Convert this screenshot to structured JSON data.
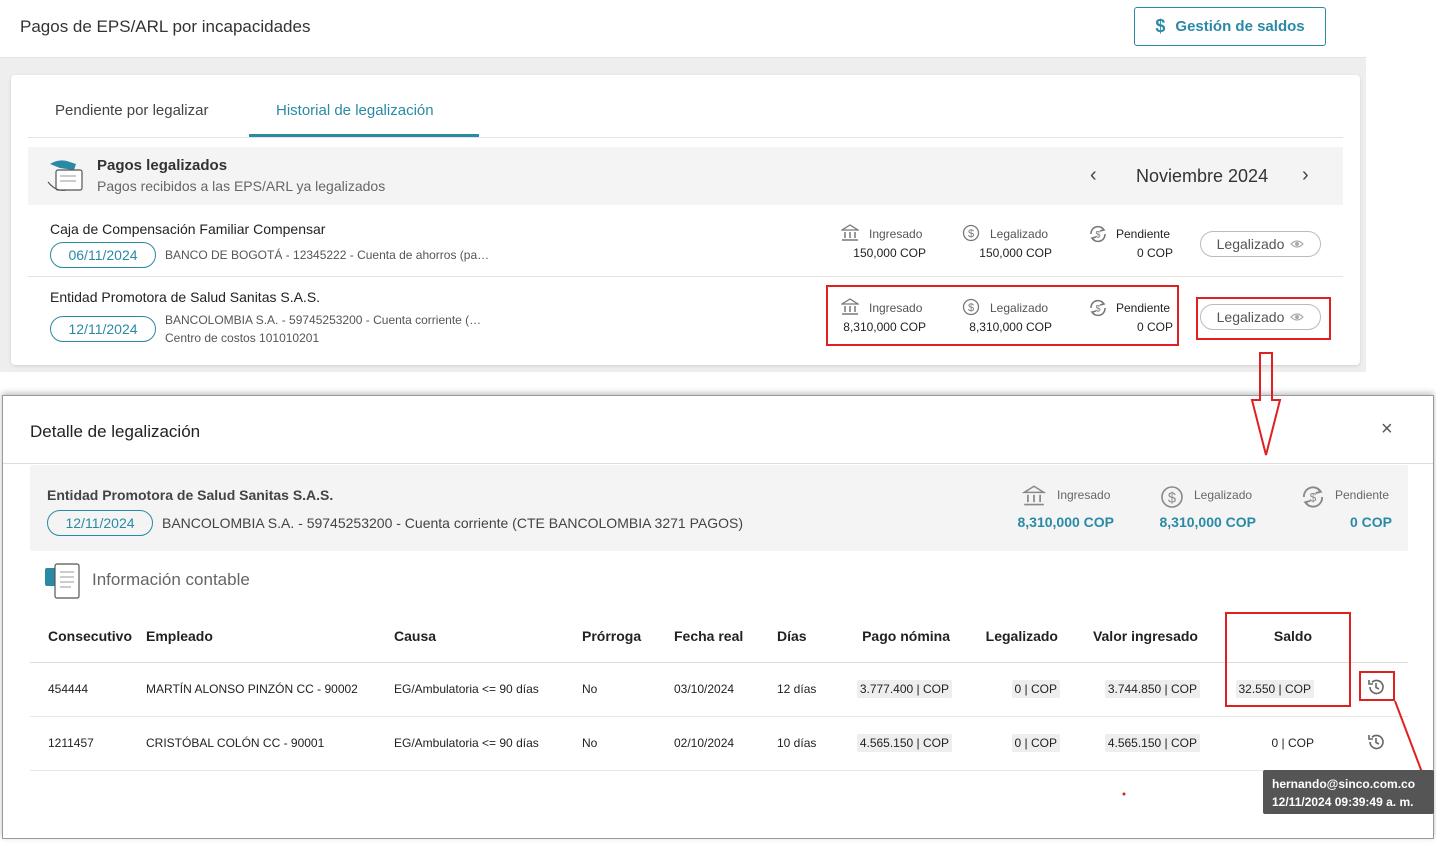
{
  "page": {
    "title": "Pagos de EPS/ARL por incapacidades",
    "saldos_button": "Gestión de saldos",
    "saldos_icon": "dollar-icon"
  },
  "tabs": [
    {
      "label": "Pendiente por legalizar",
      "active": false
    },
    {
      "label": "Historial de legalización",
      "active": true
    }
  ],
  "section": {
    "title": "Pagos legalizados",
    "subtitle": "Pagos recibidos a las EPS/ARL ya legalizados",
    "month": "Noviembre 2024"
  },
  "metric_labels": {
    "ingresado": "Ingresado",
    "legalizado": "Legalizado",
    "pendiente": "Pendiente"
  },
  "payments": [
    {
      "entity": "Caja de Compensación Familiar Compensar",
      "date": "06/11/2024",
      "bank": "BANCO DE BOGOTÁ - 12345222 - Cuenta de ahorros (pa…",
      "cost_center": "",
      "ingresado": "150,000 COP",
      "legalizado": "150,000 COP",
      "pendiente": "0 COP",
      "status": "Legalizado"
    },
    {
      "entity": "Entidad Promotora de Salud Sanitas S.A.S.",
      "date": "12/11/2024",
      "bank": "BANCOLOMBIA S.A. - 59745253200 - Cuenta corriente (…",
      "cost_center": "Centro de costos 101010201",
      "ingresado": "8,310,000 COP",
      "legalizado": "8,310,000 COP",
      "pendiente": "0 COP",
      "status": "Legalizado"
    }
  ],
  "modal": {
    "title": "Detalle de legalización",
    "close": "×",
    "entity": "Entidad Promotora de Salud Sanitas S.A.S.",
    "date": "12/11/2024",
    "bank": "BANCOLOMBIA S.A. - 59745253200 - Cuenta corriente (CTE BANCOLOMBIA 3271 PAGOS)",
    "ingresado": "8,310,000 COP",
    "legalizado": "8,310,000 COP",
    "pendiente": "0 COP",
    "info_title": "Información contable",
    "columns": [
      "Consecutivo",
      "Empleado",
      "Causa",
      "Prórroga",
      "Fecha real",
      "Días",
      "Pago nómina",
      "Legalizado",
      "Valor ingresado",
      "Saldo"
    ],
    "rows": [
      {
        "consecutivo": "454444",
        "empleado": "MARTÍN ALONSO PINZÓN CC - 90002",
        "causa": "EG/Ambulatoria <= 90 días",
        "prorroga": "No",
        "fecha": "03/10/2024",
        "dias": "12 días",
        "pago_nomina": "3.777.400 | COP",
        "legalizado": "0 | COP",
        "valor_ingresado": "3.744.850 | COP",
        "saldo": "32.550 | COP"
      },
      {
        "consecutivo": "1211457",
        "empleado": "CRISTÓBAL COLÓN CC - 90001",
        "causa": "EG/Ambulatoria <= 90 días",
        "prorroga": "No",
        "fecha": "02/10/2024",
        "dias": "10 días",
        "pago_nomina": "4.565.150 | COP",
        "legalizado": "0 | COP",
        "valor_ingresado": "4.565.150 | COP",
        "saldo": "0 | COP"
      }
    ]
  },
  "tooltip": {
    "user": "hernando@sinco.com.co",
    "datetime": "12/11/2024 09:39:49 a. m."
  },
  "colors": {
    "accent": "#2a8aa6",
    "annotation": "#e02020"
  }
}
